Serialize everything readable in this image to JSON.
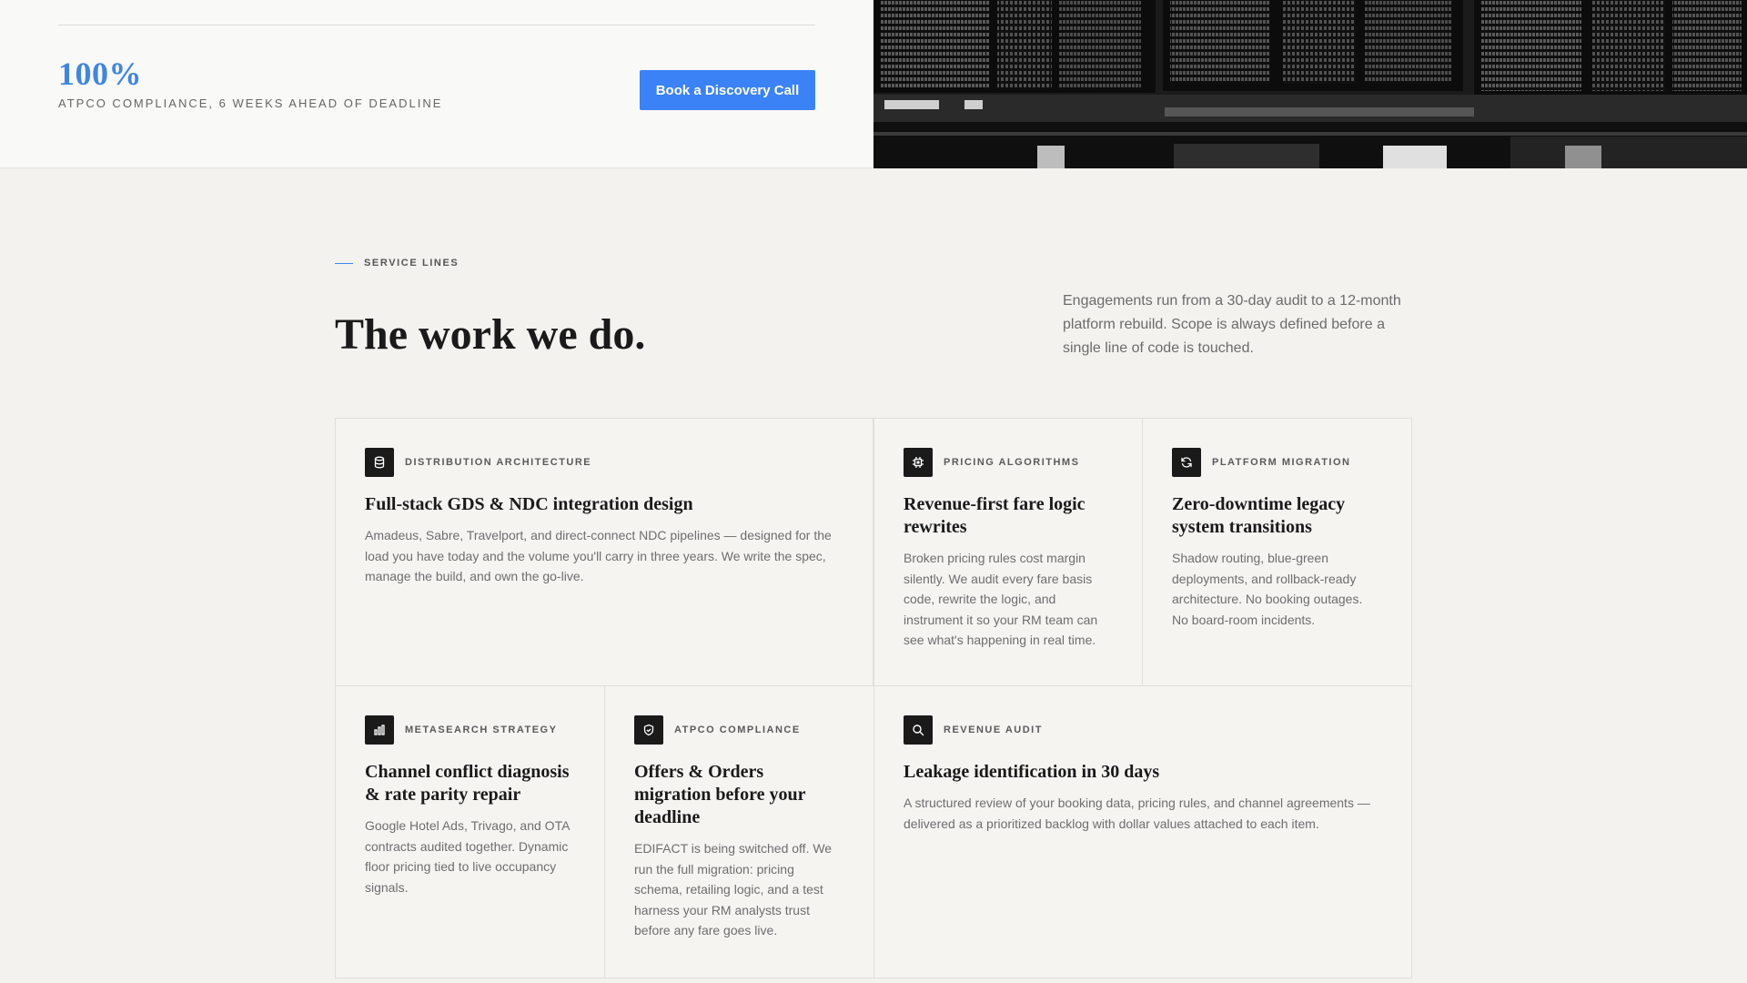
{
  "hero": {
    "stat_value": "100%",
    "stat_label": "ATPCO COMPLIANCE, 6 WEEKS AHEAD OF DEADLINE",
    "cta_label": "Book a Discovery Call",
    "photo_icon": "departures-board-photo"
  },
  "services": {
    "eyebrow": "SERVICE LINES",
    "title": "The work we do.",
    "intro": "Engagements run from a 30-day audit to a 12-month platform rebuild. Scope is always defined before a single line of code is touched.",
    "cards": [
      {
        "icon": "database-icon",
        "kicker": "DISTRIBUTION ARCHITECTURE",
        "title": "Full-stack GDS & NDC integration design",
        "body": "Amadeus, Sabre, Travelport, and direct-connect NDC pipelines — designed for the load you have today and the volume you'll carry in three years. We write the spec, manage the build, and own the go-live."
      },
      {
        "icon": "chip-icon",
        "kicker": "PRICING ALGORITHMS",
        "title": "Revenue-first fare logic rewrites",
        "body": "Broken pricing rules cost margin silently. We audit every fare basis code, rewrite the logic, and instrument it so your RM team can see what's happening in real time."
      },
      {
        "icon": "refresh-icon",
        "kicker": "PLATFORM MIGRATION",
        "title": "Zero-downtime legacy system transitions",
        "body": "Shadow routing, blue-green deployments, and rollback-ready architecture. No booking outages. No board-room incidents."
      },
      {
        "icon": "bar-chart-icon",
        "kicker": "METASEARCH STRATEGY",
        "title": "Channel conflict diagnosis & rate parity repair",
        "body": "Google Hotel Ads, Trivago, and OTA contracts audited together. Dynamic floor pricing tied to live occupancy signals."
      },
      {
        "icon": "shield-icon",
        "kicker": "ATPCO COMPLIANCE",
        "title": "Offers & Orders migration before your deadline",
        "body": "EDIFACT is being switched off. We run the full migration: pricing schema, retailing logic, and a test harness your RM analysts trust before any fare goes live."
      },
      {
        "icon": "search-icon",
        "kicker": "REVENUE AUDIT",
        "title": "Leakage identification in 30 days",
        "body": "A structured review of your booking data, pricing rules, and channel agreements — delivered as a prioritized backlog with dollar values attached to each item."
      }
    ]
  },
  "colors": {
    "accent": "#3b82f6",
    "stat": "#3f86e0",
    "ink": "#1a1a1a"
  }
}
